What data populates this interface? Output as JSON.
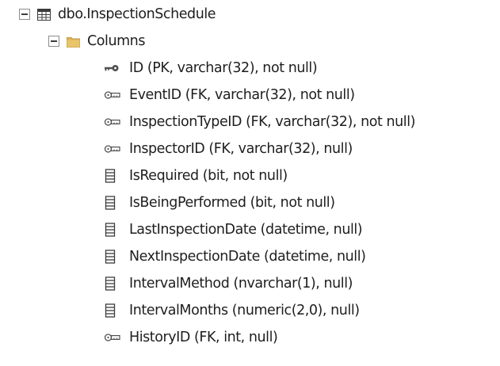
{
  "table_node": {
    "label": "dbo.InspectionSchedule",
    "icon": "table-icon",
    "expanded": true
  },
  "folder_node": {
    "label": "Columns",
    "icon": "folder-icon",
    "expanded": true
  },
  "columns": [
    {
      "label": "ID (PK, varchar(32), not null)",
      "icon": "primary-key-icon"
    },
    {
      "label": "EventID (FK, varchar(32), not null)",
      "icon": "foreign-key-icon"
    },
    {
      "label": "InspectionTypeID (FK, varchar(32), not null)",
      "icon": "foreign-key-icon"
    },
    {
      "label": "InspectorID (FK, varchar(32), null)",
      "icon": "foreign-key-icon"
    },
    {
      "label": "IsRequired (bit, not null)",
      "icon": "column-icon"
    },
    {
      "label": "IsBeingPerformed (bit, not null)",
      "icon": "column-icon"
    },
    {
      "label": "LastInspectionDate (datetime, null)",
      "icon": "column-icon"
    },
    {
      "label": "NextInspectionDate (datetime, null)",
      "icon": "column-icon"
    },
    {
      "label": "IntervalMethod (nvarchar(1), null)",
      "icon": "column-icon"
    },
    {
      "label": "IntervalMonths (numeric(2,0), null)",
      "icon": "column-icon"
    },
    {
      "label": "HistoryID (FK, int, null)",
      "icon": "foreign-key-icon"
    }
  ],
  "colors": {
    "text": "#1e1e1e",
    "folder": "#dcb35c",
    "table_icon": "#3c3c3c",
    "key_icon": "#505050"
  }
}
